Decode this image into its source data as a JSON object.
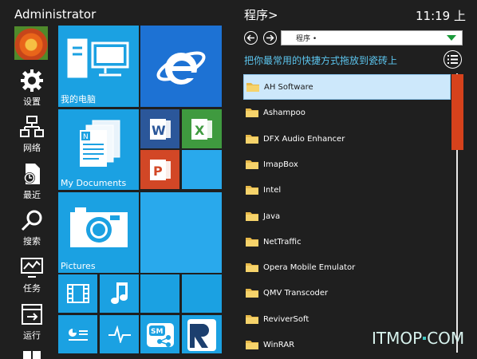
{
  "user": {
    "name": "Administrator"
  },
  "sidebar": {
    "items": [
      {
        "label": "设置"
      },
      {
        "label": "网络"
      },
      {
        "label": "最近"
      },
      {
        "label": "搜索"
      },
      {
        "label": "任务"
      },
      {
        "label": "运行"
      }
    ]
  },
  "tiles": {
    "my_computer": "我的电脑",
    "my_documents": "My Documents",
    "pictures": "Pictures"
  },
  "panel": {
    "title": "程序>",
    "clock": "11:19 上",
    "dropdown_value": "程序 •",
    "hint": "把你最常用的快捷方式拖放到瓷砖上"
  },
  "programs": [
    {
      "name": "AH Software",
      "selected": true
    },
    {
      "name": "Ashampoo"
    },
    {
      "name": "DFX Audio Enhancer"
    },
    {
      "name": "ImapBox"
    },
    {
      "name": "Intel"
    },
    {
      "name": "Java"
    },
    {
      "name": "NetTraffic"
    },
    {
      "name": "Opera Mobile Emulator"
    },
    {
      "name": "QMV Transcoder"
    },
    {
      "name": "ReviverSoft"
    },
    {
      "name": "WinRAR"
    }
  ],
  "watermark": {
    "part1": "ITMOP",
    "part2": "COM"
  },
  "colors": {
    "background": "#1f1f1f",
    "tile_blue": "#1ba1e2",
    "tile_light": "#29a9ec",
    "word": "#2b579a",
    "excel": "#3f9a3f",
    "powerpoint": "#d24726",
    "accent_text": "#5cc5ee",
    "scroll_thumb": "#d6421c"
  }
}
